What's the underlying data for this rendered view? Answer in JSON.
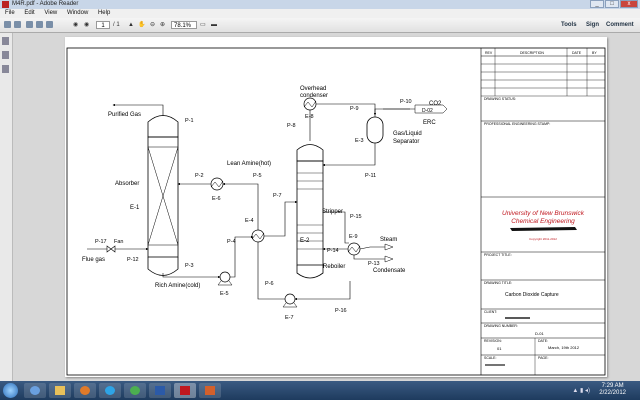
{
  "window": {
    "title": "M4R.pdf - Adobe Reader"
  },
  "menu": [
    "File",
    "Edit",
    "View",
    "Window",
    "Help"
  ],
  "toolbar": {
    "page_current": "1",
    "page_total": "/ 1",
    "zoom": "78.1%",
    "tools": "Tools",
    "sign": "Sign",
    "comment": "Comment"
  },
  "drawing": {
    "labels": {
      "purified_gas": "Purified Gas",
      "p1": "P-1",
      "lean_amine": "Lean Amine(hot)",
      "p2": "P-2",
      "p5": "P-5",
      "e6": "E-6",
      "absorber": "Absorber",
      "e1": "E-1",
      "p7": "P-7",
      "e4": "E-4",
      "p4": "P-4",
      "p17": "P-17",
      "fan": "Fan",
      "flue_gas": "Flue gas",
      "p12": "P-12",
      "p3": "P-3",
      "rich_amine": "Rich Amine(cold)",
      "e5": "E-5",
      "p6": "P-6",
      "e7": "E-7",
      "p16": "P-16",
      "overhead": "Overhead",
      "condenser": "condenser",
      "e8": "E-8",
      "p8": "P-8",
      "p9": "P-9",
      "p10": "P-10",
      "co2": "CO2",
      "d02": "D-02",
      "erc": "ERC",
      "e3": "E-3",
      "gas_liquid": "Gas/Liquid",
      "separator": "Separator",
      "p11": "P-11",
      "stripper": "Stripper",
      "e2": "E-2",
      "p15": "P-15",
      "e9": "E-9",
      "steam": "Steam",
      "p14": "P-14",
      "p13": "P-13",
      "reboiler": "Reboiler",
      "condensate": "Condensate"
    },
    "titleblock": {
      "rev": "REV",
      "description": "DESCRIPTION",
      "date": "DATE",
      "by": "BY",
      "drawing_status": "DRAWING STATUS:",
      "prof_stamp": "PROFESSIONAL ENGINEERING STAMP:",
      "university": "University of New Brunswick",
      "dept": "Chemical Engineering",
      "copyright": "Copyright 2011-2012",
      "project_title": "PROJECT TITLE:",
      "drawing_title": "DRAWING TITLE:",
      "drawing_title_value": "Carbon Dioxide Capture",
      "client": "CLIENT:",
      "drawing_number": "DRAWING NUMBER:",
      "drawing_number_value": "D-01",
      "revision": "REVISION:",
      "revision_value": "01",
      "date_label": "DATE:",
      "date_value": "March, 19th 2012",
      "scale": "SCALE:",
      "page": "PAGE:"
    }
  },
  "taskbar": {
    "time": "7:29 AM",
    "date": "2/22/2012"
  },
  "colors": {
    "accent": "#c0181f",
    "taskbar": "#1e3b5e"
  }
}
